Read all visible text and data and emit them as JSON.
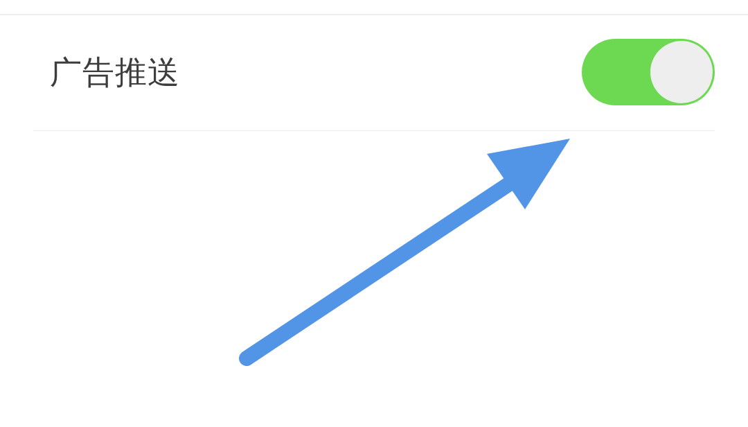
{
  "settings": [
    {
      "label": "广告推送",
      "on": true
    }
  ]
}
